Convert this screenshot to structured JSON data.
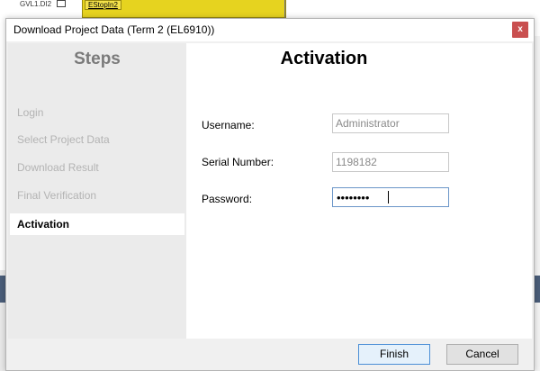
{
  "background": {
    "variable_label": "GVL1.DI2",
    "block_label": "EStopIn2"
  },
  "dialog": {
    "title": "Download Project Data (Term 2 (EL6910))",
    "close_glyph": "x"
  },
  "steps": {
    "heading": "Steps",
    "items": [
      {
        "label": "Login",
        "active": false
      },
      {
        "label": "Select Project Data",
        "active": false
      },
      {
        "label": "Download Result",
        "active": false
      },
      {
        "label": "Final Verification",
        "active": false
      },
      {
        "label": "Activation",
        "active": true
      }
    ]
  },
  "content": {
    "title": "Activation",
    "username": {
      "label": "Username:",
      "value": "Administrator"
    },
    "serial": {
      "label": "Serial Number:",
      "value": "1198182"
    },
    "password": {
      "label": "Password:",
      "masked": "••••••••"
    }
  },
  "buttons": {
    "finish": "Finish",
    "cancel": "Cancel"
  },
  "colors": {
    "close_button": "#c94f4f",
    "block_yellow": "#e6d31f",
    "focus_border": "#6a95c8",
    "default_button_border": "#4c8fd6"
  }
}
